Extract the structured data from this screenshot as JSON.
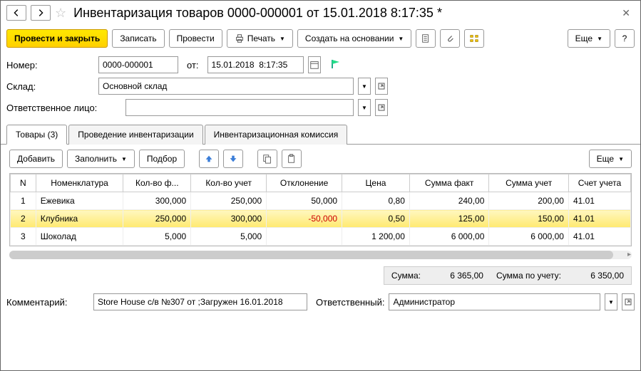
{
  "title": "Инвентаризация товаров 0000-000001 от 15.01.2018 8:17:35 *",
  "toolbar": {
    "process_close": "Провести и закрыть",
    "write": "Записать",
    "process": "Провести",
    "print": "Печать",
    "create_based": "Создать на основании",
    "more": "Еще"
  },
  "form": {
    "number_label": "Номер:",
    "number_value": "0000-000001",
    "from_label": "от:",
    "date_value": "15.01.2018  8:17:35",
    "warehouse_label": "Склад:",
    "warehouse_value": "Основной склад",
    "responsible_label": "Ответственное лицо:",
    "responsible_value": ""
  },
  "tabs": [
    {
      "label": "Товары (3)"
    },
    {
      "label": "Проведение инвентаризации"
    },
    {
      "label": "Инвентаризационная комиссия"
    }
  ],
  "table_toolbar": {
    "add": "Добавить",
    "fill": "Заполнить",
    "pick": "Подбор",
    "more": "Еще"
  },
  "columns": {
    "n": "N",
    "nomenclature": "Номенклатура",
    "qty_fact": "Кол-во ф...",
    "qty_acc": "Кол-во учет",
    "delta": "Отклонение",
    "price": "Цена",
    "sum_fact": "Сумма факт",
    "sum_acc": "Сумма учет",
    "account": "Счет учета"
  },
  "rows": [
    {
      "n": "1",
      "name": "Ежевика",
      "qty_fact": "300,000",
      "qty_acc": "250,000",
      "delta": "50,000",
      "delta_neg": false,
      "price": "0,80",
      "sum_fact": "240,00",
      "sum_acc": "200,00",
      "acc": "41.01"
    },
    {
      "n": "2",
      "name": "Клубника",
      "qty_fact": "250,000",
      "qty_acc": "300,000",
      "delta": "-50,000",
      "delta_neg": true,
      "price": "0,50",
      "sum_fact": "125,00",
      "sum_acc": "150,00",
      "acc": "41.01"
    },
    {
      "n": "3",
      "name": "Шоколад",
      "qty_fact": "5,000",
      "qty_acc": "5,000",
      "delta": "",
      "delta_neg": false,
      "price": "1 200,00",
      "sum_fact": "6 000,00",
      "sum_acc": "6 000,00",
      "acc": "41.01"
    }
  ],
  "totals": {
    "sum_label": "Сумма:",
    "sum_value": "6 365,00",
    "sum_acc_label": "Сумма по учету:",
    "sum_acc_value": "6 350,00"
  },
  "bottom": {
    "comment_label": "Комментарий:",
    "comment_value": "Store House с/в №307 от ;Загружен 16.01.2018",
    "responsible_label": "Ответственный:",
    "responsible_value": "Администратор"
  }
}
